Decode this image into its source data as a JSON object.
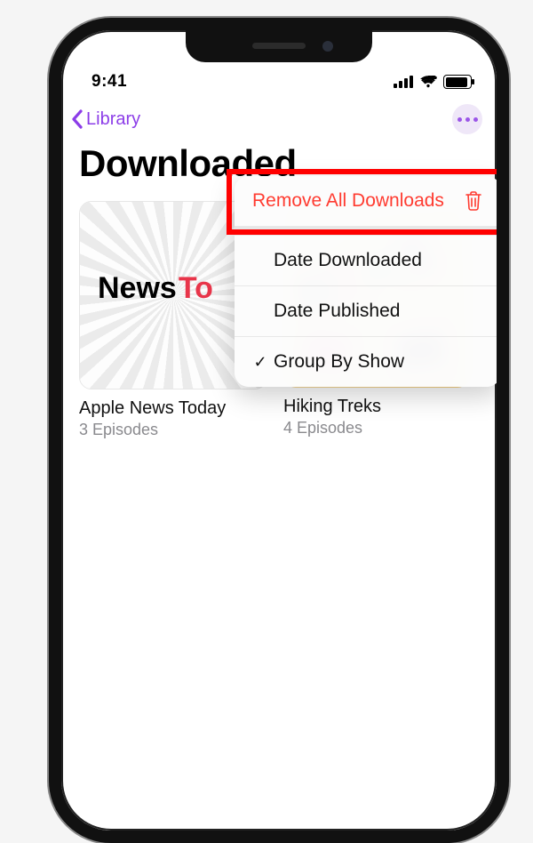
{
  "status": {
    "time": "9:41"
  },
  "nav": {
    "back_label": "Library"
  },
  "page": {
    "title": "Downloaded"
  },
  "menu": {
    "remove_all": "Remove All Downloads",
    "date_downloaded": "Date Downloaded",
    "date_published": "Date Published",
    "group_by_show": "Group By Show",
    "checkmark": "✓"
  },
  "tiles": [
    {
      "title": "Apple News Today",
      "subtitle": "3 Episodes",
      "art_text_a": "News",
      "art_text_b": "To"
    },
    {
      "title": "Hiking Treks",
      "subtitle": "4 Episodes"
    }
  ]
}
